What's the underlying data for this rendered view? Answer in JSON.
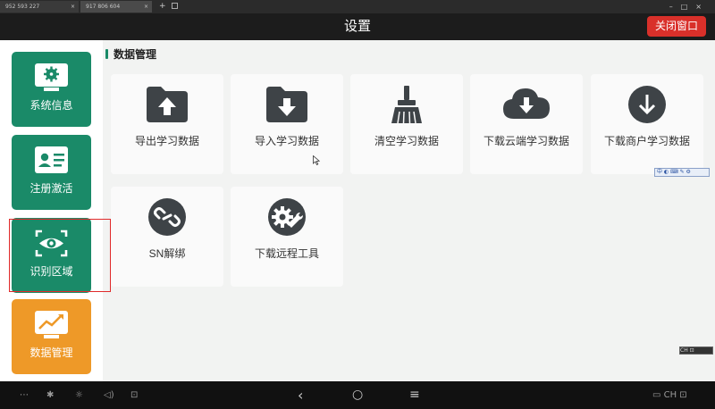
{
  "tabs": [
    {
      "label": "952 593 227"
    },
    {
      "label": "917 806 604"
    }
  ],
  "window": {
    "title": "设置",
    "close_label": "关闭窗口"
  },
  "sidebar": {
    "items": [
      {
        "label": "系统信息",
        "icon": "monitor-gear-icon"
      },
      {
        "label": "注册激活",
        "icon": "id-card-icon"
      },
      {
        "label": "识别区域",
        "icon": "eye-scan-icon"
      },
      {
        "label": "数据管理",
        "icon": "chart-monitor-icon"
      }
    ]
  },
  "section": {
    "title": "数据管理"
  },
  "cards": [
    {
      "label": "导出学习数据",
      "icon": "folder-upload-icon"
    },
    {
      "label": "导入学习数据",
      "icon": "folder-download-icon"
    },
    {
      "label": "清空学习数据",
      "icon": "broom-icon"
    },
    {
      "label": "下载云端学习数据",
      "icon": "cloud-download-icon"
    },
    {
      "label": "下载商户学习数据",
      "icon": "download-circle-icon"
    },
    {
      "label": "SN解绑",
      "icon": "unlink-icon"
    },
    {
      "label": "下载远程工具",
      "icon": "gear-wrench-icon"
    }
  ],
  "colors": {
    "accent_green": "#1a8a68",
    "accent_orange": "#ee9928",
    "close_red": "#d9302a",
    "icon_dark": "#3e4347"
  }
}
